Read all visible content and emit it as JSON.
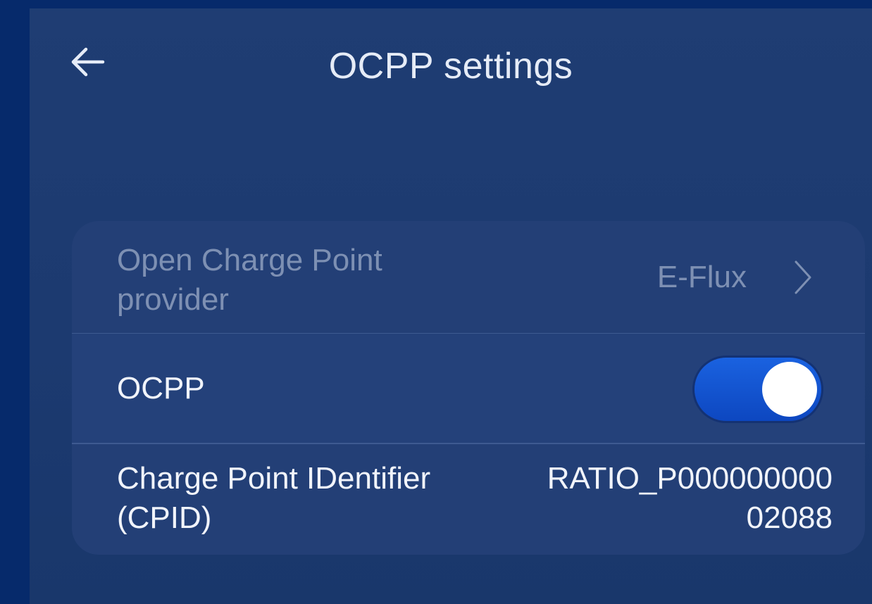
{
  "header": {
    "title": "OCPP settings",
    "back_icon": "arrow-left-icon"
  },
  "settings": {
    "provider": {
      "label": "Open Charge Point provider",
      "value": "E-Flux",
      "icon": "chevron-right-icon",
      "enabled": false
    },
    "ocpp": {
      "label": "OCPP",
      "toggle_on": true
    },
    "cpid": {
      "label": "Charge Point IDentifier (CPID)",
      "value": "RATIO_P00000000002088"
    }
  },
  "colors": {
    "background": "#062a6b",
    "screen": "#1f3d73",
    "card": "#233f76",
    "toggle_active": "#1a62e0",
    "text": "#f1f4fb"
  }
}
